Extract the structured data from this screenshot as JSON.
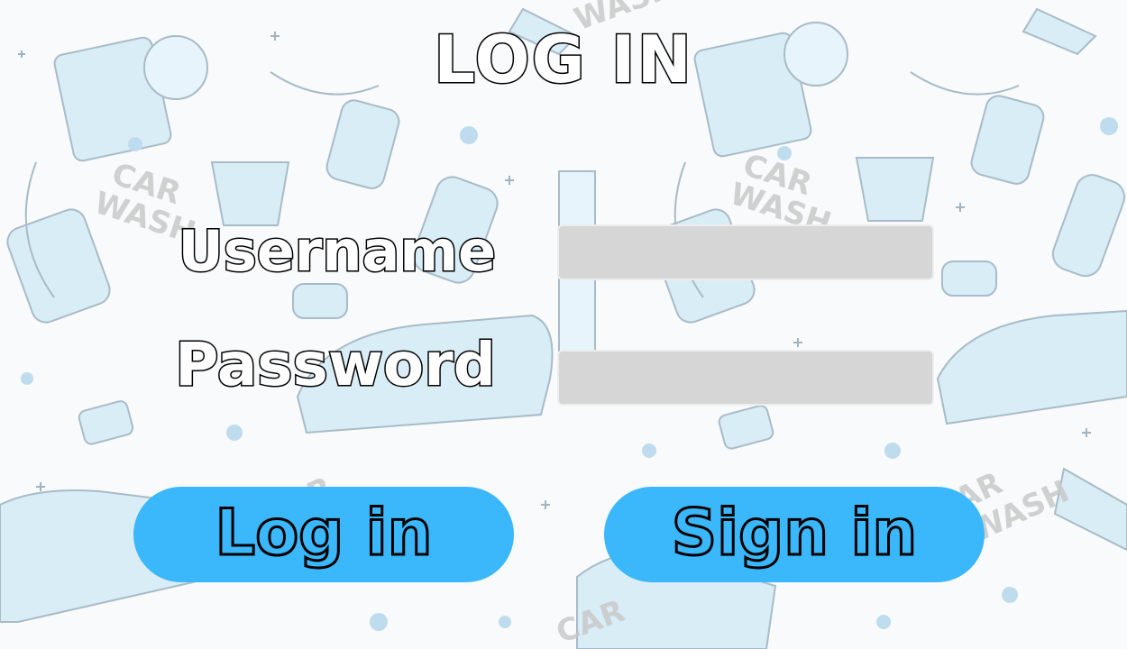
{
  "page": {
    "title": "LOG IN"
  },
  "form": {
    "username_label": "Username",
    "password_label": "Password",
    "username_value": "",
    "password_value": ""
  },
  "buttons": {
    "login_label": "Log in",
    "signin_label": "Sign in"
  },
  "background": {
    "theme": "car wash doodle pattern",
    "texts": [
      "CAR",
      "WASH"
    ]
  },
  "colors": {
    "button": "#3bb8fb",
    "field": "#d6d6d6",
    "doodle": "#cfe8f6",
    "outline": "#000000"
  }
}
